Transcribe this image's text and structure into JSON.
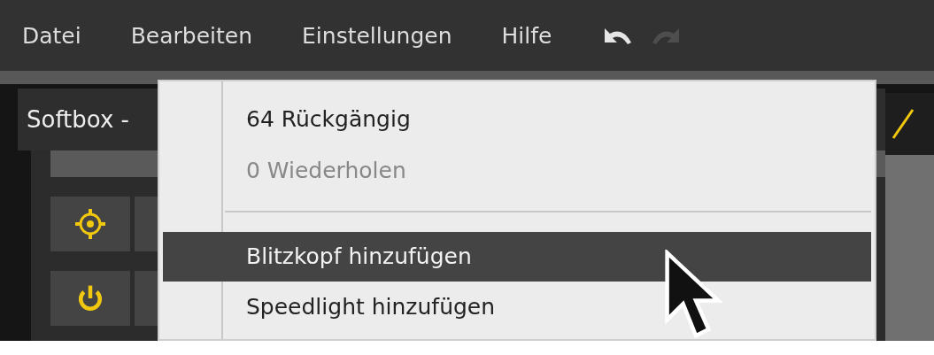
{
  "menu_bar": {
    "items": [
      {
        "label": "Datei"
      },
      {
        "label": "Bearbeiten"
      },
      {
        "label": "Einstellungen"
      },
      {
        "label": "Hilfe"
      }
    ],
    "undo": {
      "disabled": false
    },
    "redo": {
      "disabled": true
    }
  },
  "panel": {
    "title": "Softbox -",
    "tools": [
      {
        "kind": "target"
      },
      {
        "kind": "power"
      }
    ]
  },
  "dropdown": {
    "items": [
      {
        "kind": "item",
        "label": "64 Rückgängig",
        "disabled": false,
        "selected": false
      },
      {
        "kind": "item",
        "label": "0 Wiederholen",
        "disabled": true,
        "selected": false
      },
      {
        "kind": "separator"
      },
      {
        "kind": "item",
        "label": "Blitzkopf hinzufügen",
        "disabled": false,
        "selected": true
      },
      {
        "kind": "item",
        "label": "Speedlight hinzufügen",
        "disabled": false,
        "selected": false
      }
    ]
  }
}
